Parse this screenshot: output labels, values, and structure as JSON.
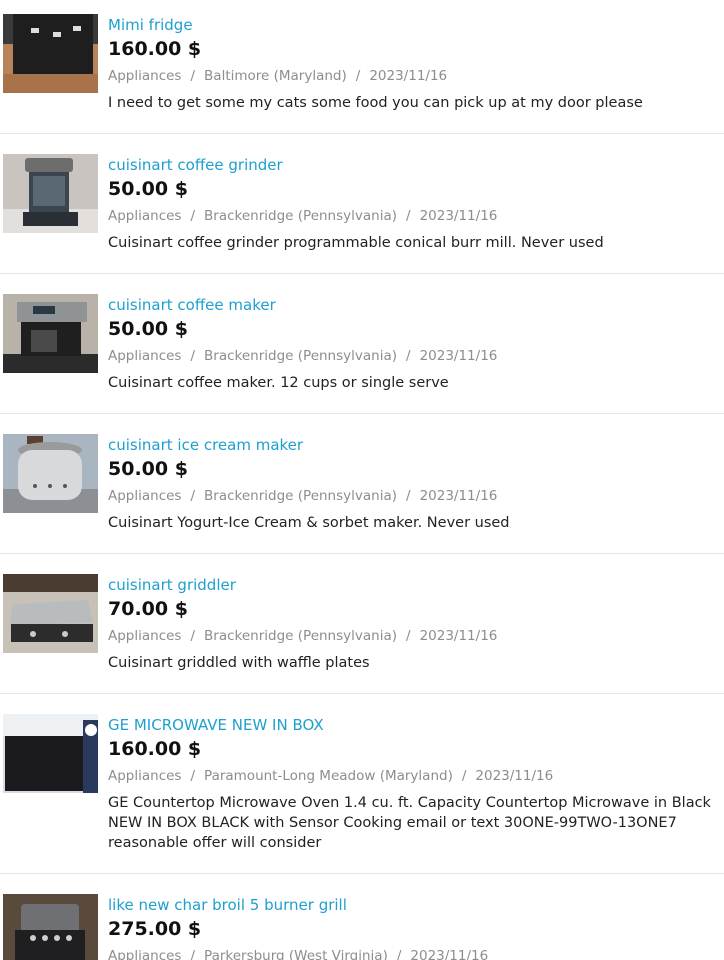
{
  "listings": [
    {
      "title": "Mimi fridge",
      "price": "160.00 $",
      "category": "Appliances",
      "location": "Baltimore (Maryland)",
      "date": "2023/11/16",
      "description": "I need to get some my cats some food you can pick up at my door please",
      "thumbnail_icon": "mini-fridge-photo"
    },
    {
      "title": "cuisinart coffee grinder",
      "price": "50.00 $",
      "category": "Appliances",
      "location": "Brackenridge (Pennsylvania)",
      "date": "2023/11/16",
      "description": "Cuisinart coffee grinder programmable conical burr mill. Never used",
      "thumbnail_icon": "coffee-grinder-photo"
    },
    {
      "title": "cuisinart coffee maker",
      "price": "50.00 $",
      "category": "Appliances",
      "location": "Brackenridge (Pennsylvania)",
      "date": "2023/11/16",
      "description": "Cuisinart coffee maker. 12 cups or single serve",
      "thumbnail_icon": "coffee-maker-photo"
    },
    {
      "title": "cuisinart ice cream maker",
      "price": "50.00 $",
      "category": "Appliances",
      "location": "Brackenridge (Pennsylvania)",
      "date": "2023/11/16",
      "description": "Cuisinart Yogurt-Ice Cream & sorbet maker. Never used",
      "thumbnail_icon": "ice-cream-maker-photo"
    },
    {
      "title": "cuisinart griddler",
      "price": "70.00 $",
      "category": "Appliances",
      "location": "Brackenridge (Pennsylvania)",
      "date": "2023/11/16",
      "description": "Cuisinart griddled with waffle plates",
      "thumbnail_icon": "griddler-photo"
    },
    {
      "title": "GE MICROWAVE NEW IN BOX",
      "price": "160.00 $",
      "category": "Appliances",
      "location": "Paramount-Long Meadow (Maryland)",
      "date": "2023/11/16",
      "description": "GE Countertop Microwave Oven 1.4 cu. ft. Capacity Countertop Microwave in Black NEW IN BOX BLACK with Sensor Cooking email or text 30ONE-99TWO-13ONE7 reasonable offer will consider",
      "thumbnail_icon": "microwave-box-photo"
    },
    {
      "title": "like new char broil 5 burner grill",
      "price": "275.00 $",
      "category": "Appliances",
      "location": "Parkersburg (West Virginia)",
      "date": "2023/11/16",
      "description": "",
      "thumbnail_icon": "grill-photo"
    }
  ],
  "separator": "/",
  "colors": {
    "title_link": "#1ea0cf",
    "price": "#111111",
    "meta": "#8d8d8d",
    "description": "#222222",
    "divider": "#e6e6e6"
  }
}
